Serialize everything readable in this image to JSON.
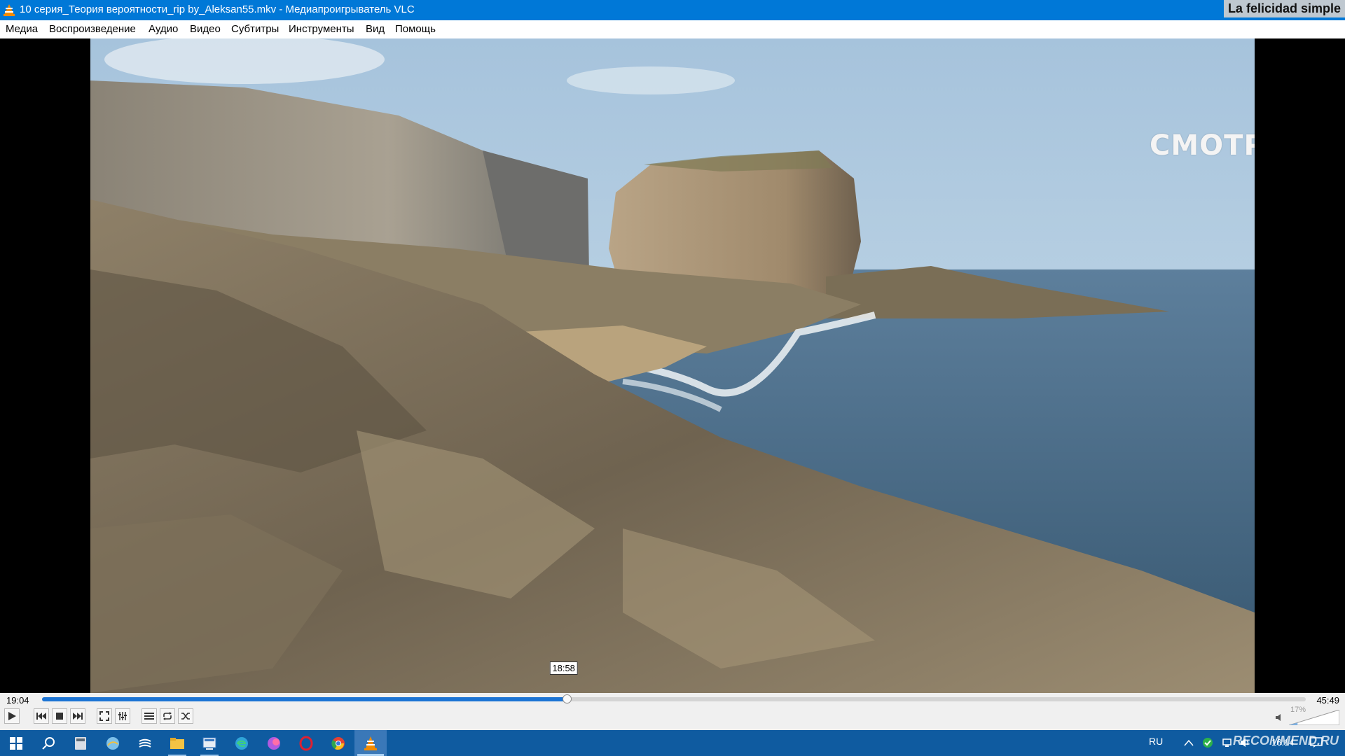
{
  "window": {
    "title": "10 серия_Теория вероятности_rip by_Aleksan55.mkv - Медиапроигрыватель VLC",
    "overlay_song": "La felicidad simple"
  },
  "menu": {
    "items": [
      "Медиа",
      "Воспроизведение",
      "Аудио",
      "Видео",
      "Субтитры",
      "Инструменты",
      "Вид",
      "Помощь"
    ]
  },
  "video": {
    "channel_logo": "СМОТРИМ"
  },
  "playback": {
    "elapsed": "19:04",
    "total": "45:49",
    "hover_time": "18:58",
    "progress_fraction": 0.415,
    "volume_label": "17%",
    "volume_fraction": 0.17
  },
  "controls": {
    "buttons": [
      "play-icon",
      "previous-icon",
      "stop-icon",
      "next-icon",
      "fullscreen-icon",
      "extended-settings-icon",
      "playlist-icon",
      "loop-icon",
      "shuffle-icon"
    ]
  },
  "taskbar": {
    "apps": [
      "start-icon",
      "search-icon",
      "calculator-icon",
      "app-icon",
      "app-icon",
      "file-explorer-icon",
      "app-icon",
      "edge-icon",
      "app-icon",
      "opera-icon",
      "chrome-icon",
      "vlc-icon"
    ],
    "language": "RU",
    "clock": "16:14",
    "watermark": "RECOMMEND.RU"
  },
  "colors": {
    "titlebar": "#0078d7",
    "seek_fill": "#1c74d4",
    "taskbar": "#0f5ba0"
  }
}
